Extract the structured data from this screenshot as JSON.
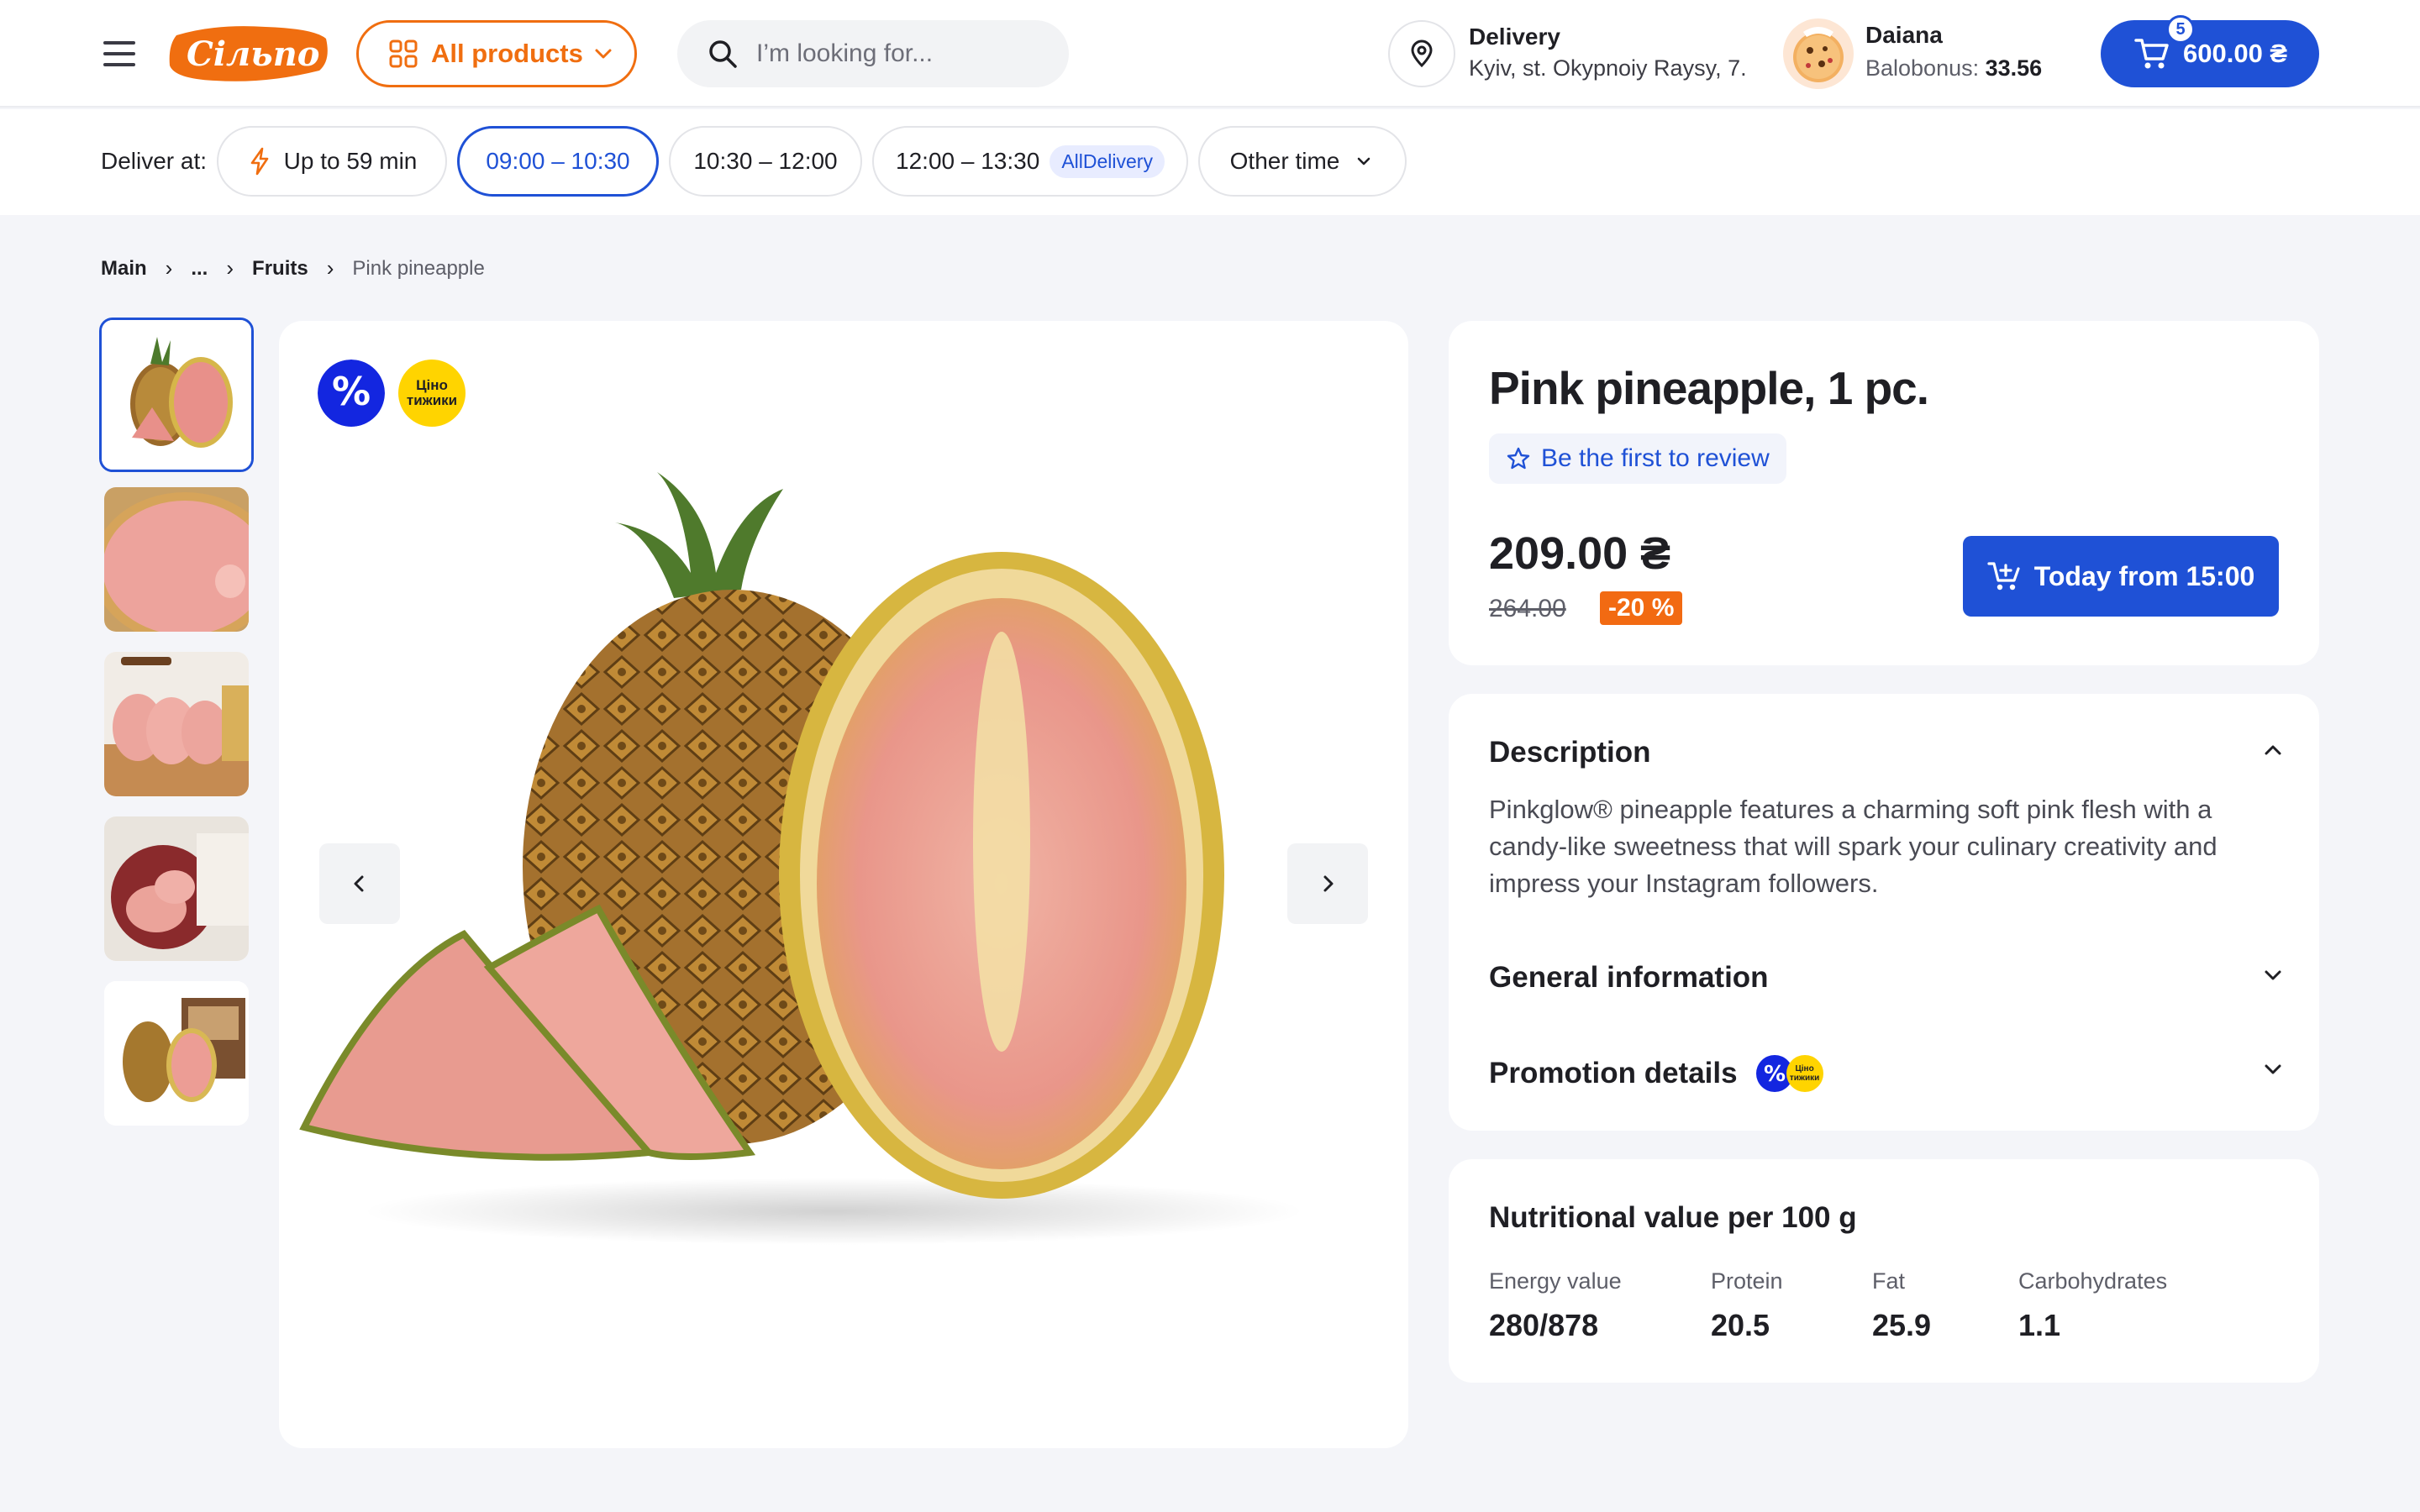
{
  "header": {
    "logo_text": "Сільпо",
    "all_products_label": "All products",
    "search_placeholder": "I’m looking for...",
    "delivery_title": "Delivery",
    "delivery_address": "Kyiv, st. Okypnoiy Raysy, 7.",
    "user_name": "Daiana",
    "bonus_label": "Balobonus: ",
    "bonus_value": "33.56",
    "cart_total": "600.00 ₴",
    "cart_count": "5"
  },
  "slots": {
    "label": "Deliver at:",
    "items": [
      {
        "text": "Up to 59 min"
      },
      {
        "text": "09:00 – 10:30"
      },
      {
        "text": "10:30 – 12:00"
      },
      {
        "text": "12:00 – 13:30",
        "tag": "AllDelivery"
      },
      {
        "text": "Other time"
      }
    ]
  },
  "breadcrumb": [
    "Main",
    "...",
    "Fruits",
    "Pink pineapple"
  ],
  "badges": {
    "promo_text": "Ціно тижики"
  },
  "product": {
    "title": "Pink pineapple, 1 pc.",
    "review_label": "Be the first to review",
    "price": "209.00 ₴",
    "old_price": "264.00",
    "discount": "-20 %",
    "buy_label": "Today from 15:00"
  },
  "details": {
    "description_title": "Description",
    "description_text": "Pinkglow® pineapple features a charming soft pink flesh with a candy-like sweetness that will spark your culinary creativity and impress your Instagram followers.",
    "general_title": "General information",
    "promo_title": "Promotion details"
  },
  "nutrition": {
    "title": "Nutritional value per 100 g",
    "items": [
      {
        "label": "Energy value",
        "value": "280/878"
      },
      {
        "label": "Protein",
        "value": "20.5"
      },
      {
        "label": "Fat",
        "value": "25.9"
      },
      {
        "label": "Carbohydrates",
        "value": "1.1"
      }
    ]
  },
  "colors": {
    "accent_blue": "#1f51d6",
    "brand_orange": "#f06e10",
    "promo_yellow": "#ffd400",
    "background": "#f4f5f9"
  }
}
